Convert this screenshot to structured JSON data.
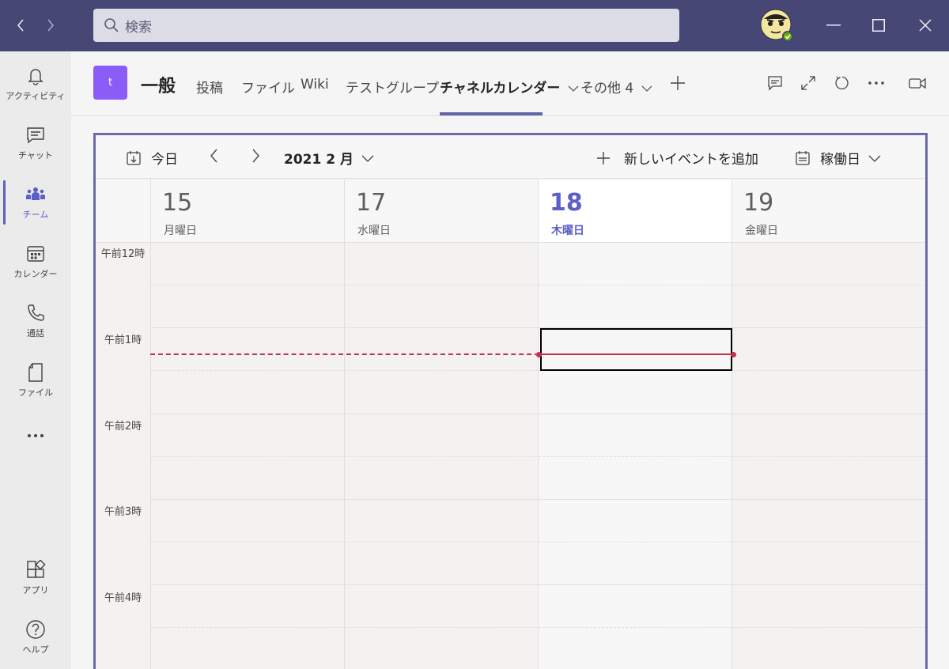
{
  "titlebar": {
    "search_placeholder": "検索"
  },
  "rail": {
    "items": [
      {
        "label": "アクティビティ",
        "icon": "bell-icon"
      },
      {
        "label": "チャット",
        "icon": "chat-icon"
      },
      {
        "label": "チーム",
        "icon": "teams-icon"
      },
      {
        "label": "カレンダー",
        "icon": "calendar-icon"
      },
      {
        "label": "通話",
        "icon": "phone-icon"
      },
      {
        "label": "ファイル",
        "icon": "file-icon"
      },
      {
        "label": "アプリ",
        "icon": "apps-icon"
      },
      {
        "label": "ヘルプ",
        "icon": "help-icon"
      }
    ]
  },
  "channel": {
    "team_initial": "t",
    "name": "一般",
    "tabs": [
      "投稿",
      "ファイル",
      "Wiki",
      "テストグループ",
      "チャネルカレンダー",
      "その他 4"
    ]
  },
  "calendar": {
    "today_label": "今日",
    "month_label": "2021 2 月",
    "new_event_label": "新しいイベントを追加",
    "view_label": "稼働日",
    "days": [
      {
        "num": "15",
        "name": "月曜日"
      },
      {
        "num": "17",
        "name": "水曜日"
      },
      {
        "num": "18",
        "name": "木曜日"
      },
      {
        "num": "19",
        "name": "金曜日"
      }
    ],
    "times": [
      "午前12時",
      "午前1時",
      "午前2時",
      "午前3時",
      "午前4時"
    ],
    "accent_color": "#5b5fc7",
    "now_line_color": "#c4314b"
  }
}
